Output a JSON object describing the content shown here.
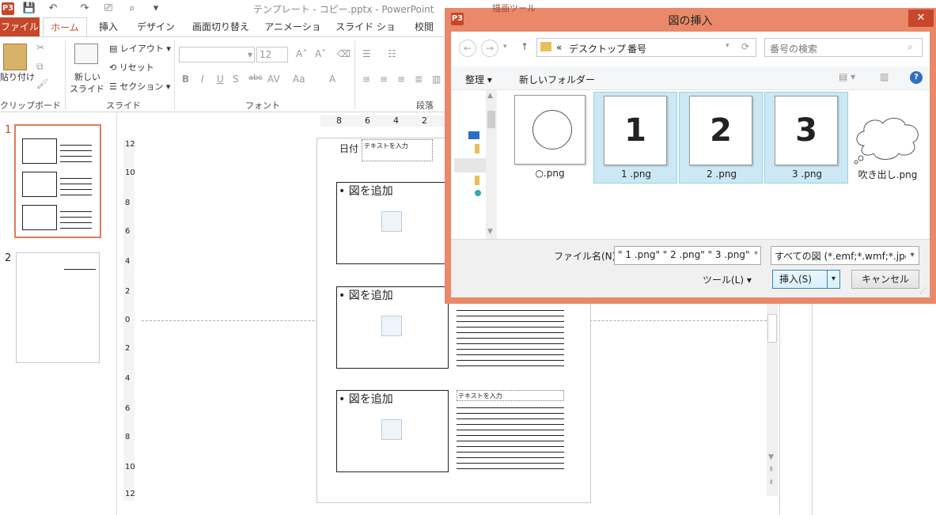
{
  "app": {
    "window_title": "テンプレート - コピー.pptx - PowerPoint",
    "app_badge": "P3"
  },
  "tabs": [
    "ファイル",
    "ホーム",
    "挿入",
    "デザイン",
    "画面切り替え",
    "アニメーション",
    "スライド ショー",
    "校閲"
  ],
  "ribbon": {
    "clipboard": {
      "paste_label": "貼り付け",
      "group_label": "クリップボード"
    },
    "slides": {
      "new_slide_label": "新しい\nスライド",
      "new_slide_line1": "新しい",
      "new_slide_line2": "スライド",
      "layout": "レイアウト",
      "reset": "リセット",
      "section": "セクション",
      "group_label": "スライド"
    },
    "font": {
      "size": "12",
      "group_label": "フォント"
    },
    "paragraph": {
      "group_label": "段落"
    }
  },
  "thumbnails": [
    {
      "num": "1"
    },
    {
      "num": "2"
    }
  ],
  "slide": {
    "date_label": "日付",
    "text_placeholder": "テキストを入力",
    "add_picture": "図を追加"
  },
  "ruler": {
    "h_ticks": [
      "8",
      "6",
      "4",
      "2"
    ],
    "v_ticks": [
      "12",
      "10",
      "8",
      "6",
      "4",
      "2",
      "0",
      "2",
      "4",
      "6",
      "8",
      "10",
      "12"
    ]
  },
  "dialog": {
    "title": "図の挿入",
    "badge": "P3",
    "behind_tab": "描画ツール",
    "path_prefix": "«",
    "path": [
      "デスクトップ",
      "番号"
    ],
    "search_placeholder": "番号の検索",
    "organize": "整理",
    "new_folder": "新しいフォルダー",
    "files": [
      {
        "name": "○.png",
        "selected": false,
        "kind": "circle"
      },
      {
        "name": "1 .png",
        "selected": true,
        "kind": "number",
        "num": "1"
      },
      {
        "name": "2 .png",
        "selected": true,
        "kind": "number",
        "num": "2"
      },
      {
        "name": "3 .png",
        "selected": true,
        "kind": "number",
        "num": "3"
      },
      {
        "name": "吹き出し.png",
        "selected": false,
        "kind": "cloud"
      }
    ],
    "filename_label": "ファイル名(N):",
    "filename_value": "\" 1 .png\" \" 2 .png\" \" 3 .png\"",
    "filetype_value": "すべての図 (*.emf;*.wmf;*.jpg",
    "tools": "ツール(L)",
    "insert": "挿入(S)",
    "cancel": "キャンセル"
  },
  "colors": {
    "accent": "#c7472a",
    "dialog_frame": "#e9896a",
    "selection": "#cce8f4"
  }
}
